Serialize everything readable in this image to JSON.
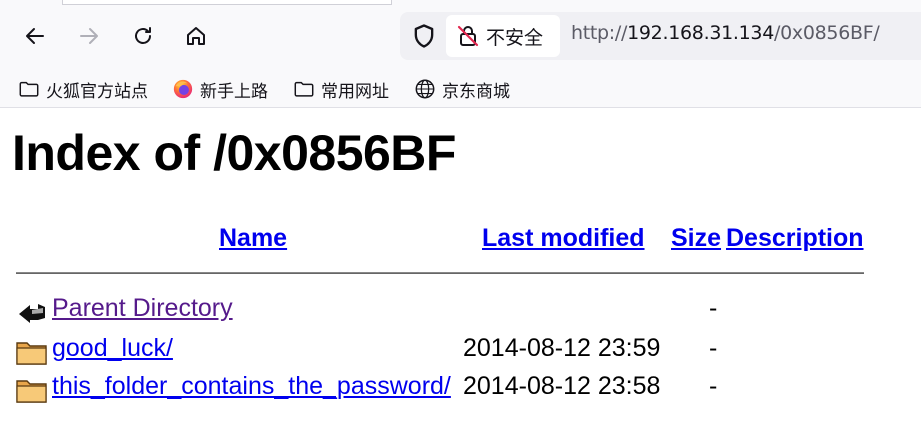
{
  "browser": {
    "security_label": "不安全",
    "url_prefix": "http://",
    "url_host": "192.168.31.134",
    "url_path": "/0x0856BF/"
  },
  "bookmarks": [
    {
      "label": "火狐官方站点",
      "icon": "folder-icon"
    },
    {
      "label": "新手上路",
      "icon": "firefox-icon"
    },
    {
      "label": "常用网址",
      "icon": "folder-icon"
    },
    {
      "label": "京东商城",
      "icon": "globe-icon"
    }
  ],
  "page": {
    "title": "Index of /0x0856BF",
    "headers": {
      "name": "Name",
      "last_modified": "Last modified",
      "size": "Size",
      "description": "Description"
    },
    "rows": [
      {
        "icon": "back-arrow-icon",
        "name": "Parent Directory",
        "date": "",
        "size": "-",
        "visited": true
      },
      {
        "icon": "folder-icon",
        "name": "good_luck/",
        "date": "2014-08-12 23:59",
        "size": "-",
        "visited": false
      },
      {
        "icon": "folder-icon",
        "name": "this_folder_contains_the_password/",
        "date": "2014-08-12 23:58",
        "size": "-",
        "visited": false
      }
    ]
  },
  "colors": {
    "link": "#0000ee",
    "visited_link": "#551a8b",
    "chrome_bg": "#f9f9fb",
    "urlbar_bg": "#f0f0f4",
    "insecure_red": "#e22850"
  }
}
